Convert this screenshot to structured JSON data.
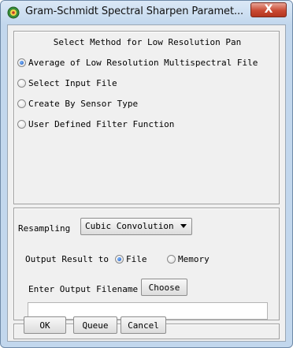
{
  "window": {
    "title": "Gram-Schmidt Spectral Sharpen Paramet...",
    "close_glyph": "X"
  },
  "method": {
    "heading": "Select Method for Low Resolution Pan",
    "options": [
      {
        "label": "Average of Low Resolution Multispectral File",
        "selected": true
      },
      {
        "label": "Select Input File",
        "selected": false
      },
      {
        "label": "Create By Sensor Type",
        "selected": false
      },
      {
        "label": "User Defined Filter Function",
        "selected": false
      }
    ]
  },
  "output": {
    "resampling_label": "Resampling",
    "resampling_value": "Cubic Convolution",
    "output_to_label": "Output Result to",
    "output_options": [
      {
        "label": "File",
        "selected": true
      },
      {
        "label": "Memory",
        "selected": false
      }
    ],
    "filename_label": "Enter Output Filename",
    "choose_label": "Choose",
    "filename_value": ""
  },
  "buttons": {
    "ok": "OK",
    "queue": "Queue",
    "cancel": "Cancel"
  }
}
